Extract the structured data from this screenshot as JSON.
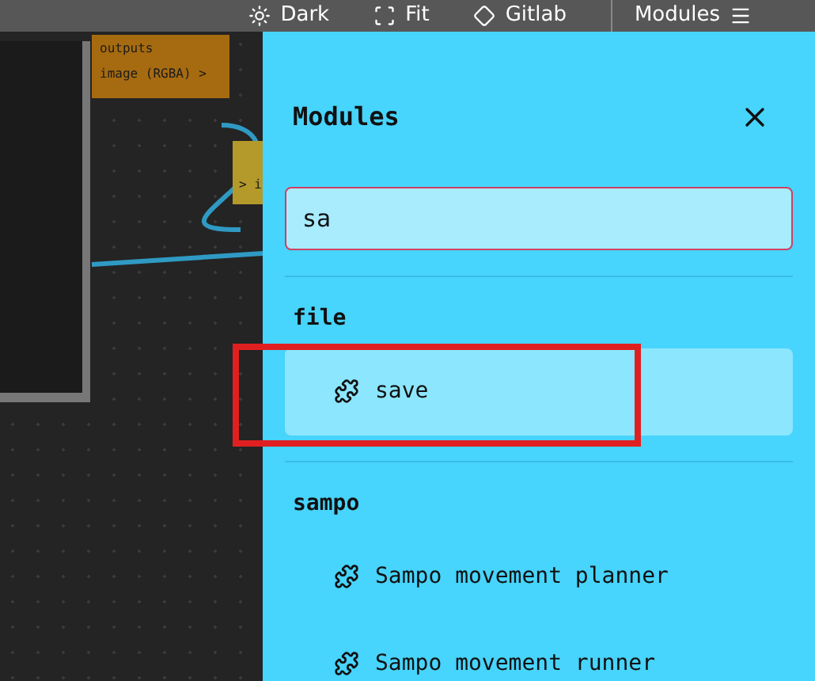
{
  "toolbar": [
    {
      "label": "Dark",
      "kind": "theme"
    },
    {
      "label": "Fit",
      "kind": "fit"
    },
    {
      "label": "Gitlab",
      "kind": "git"
    },
    {
      "label": "Modules",
      "kind": "menu"
    }
  ],
  "canvas": {
    "nodes": [
      {
        "kind": "output",
        "title": "outputs",
        "port": "image (RGBA) >"
      },
      {
        "kind": "input",
        "port": "> i"
      }
    ]
  },
  "panel": {
    "title": "Modules",
    "search": {
      "value": "sa"
    },
    "groups": [
      {
        "name": "file",
        "items": [
          {
            "label": "save",
            "selected": true,
            "annotated": true
          }
        ]
      },
      {
        "name": "sampo",
        "items": [
          {
            "label": "Sampo movement planner",
            "selected": false,
            "annotated": false
          },
          {
            "label": "Sampo movement runner",
            "selected": false,
            "annotated": false
          }
        ]
      }
    ]
  }
}
